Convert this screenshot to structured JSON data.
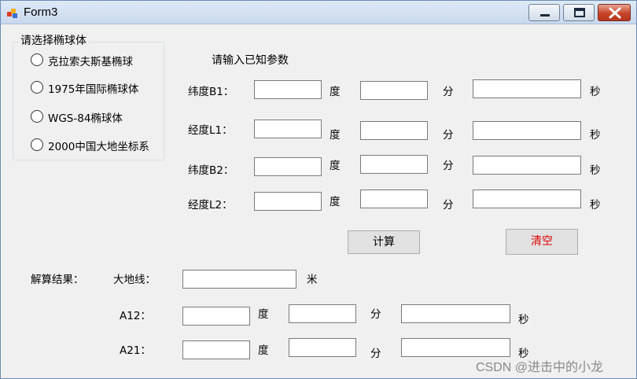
{
  "window": {
    "title": "Form3",
    "close_color": "#c7452a"
  },
  "ellipsoid_group": {
    "title": "请选择椭球体",
    "options": [
      "克拉索夫斯基椭球",
      "1975年国际椭球体",
      "WGS-84椭球体",
      "2000中国大地坐标系"
    ]
  },
  "inputs_section": {
    "title": "请输入已知参数",
    "rows": [
      {
        "label": "纬度B1：",
        "deg_unit": "度",
        "min_unit": "分",
        "sec_unit": "秒"
      },
      {
        "label": "经度L1：",
        "deg_unit": "度",
        "min_unit": "分",
        "sec_unit": "秒"
      },
      {
        "label": "纬度B2：",
        "deg_unit": "度",
        "min_unit": "分",
        "sec_unit": "秒"
      },
      {
        "label": "经度L2：",
        "deg_unit": "度",
        "min_unit": "分",
        "sec_unit": "秒"
      }
    ]
  },
  "buttons": {
    "calculate": "计算",
    "clear": "清空",
    "clear_color": "#e00000"
  },
  "results": {
    "title": "解算结果：",
    "geodesic_label": "大地线：",
    "geodesic_unit": "米",
    "a12_label": "A12：",
    "a21_label": "A21：",
    "deg_unit": "度",
    "min_unit": "分",
    "sec_unit": "秒"
  },
  "watermark": "CSDN @进击中的小龙"
}
